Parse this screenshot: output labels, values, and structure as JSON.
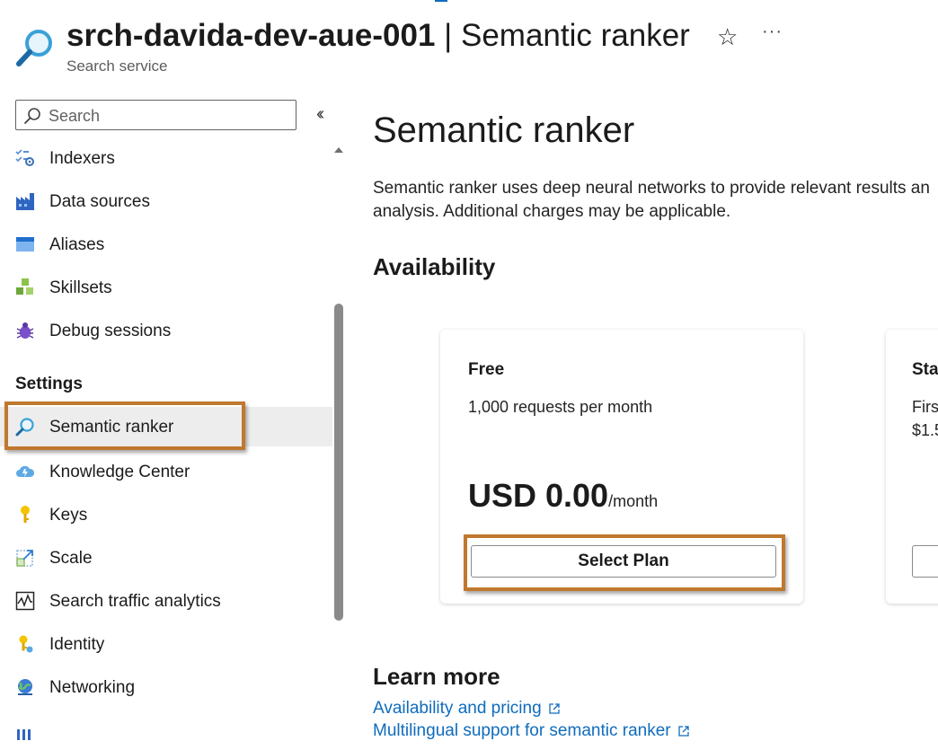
{
  "header": {
    "resource_name": "srch-davida-dev-aue-001",
    "separator": " | ",
    "page_name": "Semantic ranker",
    "subtitle": "Search service",
    "favorite_icon": "star-icon",
    "more_icon": "ellipsis-icon"
  },
  "sidebar": {
    "search_placeholder": "Search",
    "collapse_icon": "double-chevron-left-icon",
    "items_top": [
      {
        "label": "Indexers",
        "icon": "indexers-icon"
      },
      {
        "label": "Data sources",
        "icon": "data-sources-icon"
      },
      {
        "label": "Aliases",
        "icon": "aliases-icon"
      },
      {
        "label": "Skillsets",
        "icon": "skillsets-icon"
      },
      {
        "label": "Debug sessions",
        "icon": "bug-icon"
      }
    ],
    "settings_header": "Settings",
    "items_settings": [
      {
        "label": "Semantic ranker",
        "icon": "semantic-search-icon",
        "selected": true
      },
      {
        "label": "Knowledge Center",
        "icon": "knowledge-cloud-icon"
      },
      {
        "label": "Keys",
        "icon": "key-icon"
      },
      {
        "label": "Scale",
        "icon": "scale-icon"
      },
      {
        "label": "Search traffic analytics",
        "icon": "analytics-icon"
      },
      {
        "label": "Identity",
        "icon": "identity-key-icon"
      },
      {
        "label": "Networking",
        "icon": "networking-globe-icon"
      }
    ]
  },
  "main": {
    "title": "Semantic ranker",
    "description_line1": "Semantic ranker uses deep neural networks to provide relevant results an",
    "description_line2": "analysis. Additional charges may be applicable.",
    "availability_header": "Availability",
    "plans": [
      {
        "name": "Free",
        "description": "1,000 requests per month",
        "price": "USD 0.00",
        "period": "/month",
        "button_label": "Select Plan"
      },
      {
        "name": "Sta",
        "line1": "Firs",
        "line2": "$1.5"
      }
    ],
    "learn_more_header": "Learn more",
    "links": [
      {
        "label": "Availability and pricing"
      },
      {
        "label": "Multilingual support for semantic ranker"
      }
    ]
  },
  "colors": {
    "highlight": "#c0782e",
    "link": "#0f6cbd",
    "selected_bg": "#ededed"
  }
}
